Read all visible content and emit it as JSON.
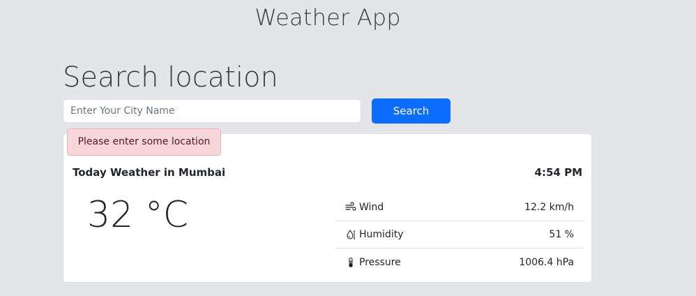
{
  "app_title": "Weather App",
  "search": {
    "heading": "Search location",
    "placeholder": "Enter Your City Name",
    "value": "",
    "button_label": "Search"
  },
  "alert": {
    "message": "Please enter some location"
  },
  "weather": {
    "title": "Today Weather in Mumbai",
    "time": "4:54 PM",
    "temperature": "32 °C",
    "details": [
      {
        "icon": "wind-icon",
        "label": "Wind",
        "value": "12.2 km/h"
      },
      {
        "icon": "humidity-icon",
        "label": "Humidity",
        "value": "51 %"
      },
      {
        "icon": "thermometer-icon",
        "label": "Pressure",
        "value": "1006.4 hPa"
      }
    ]
  }
}
